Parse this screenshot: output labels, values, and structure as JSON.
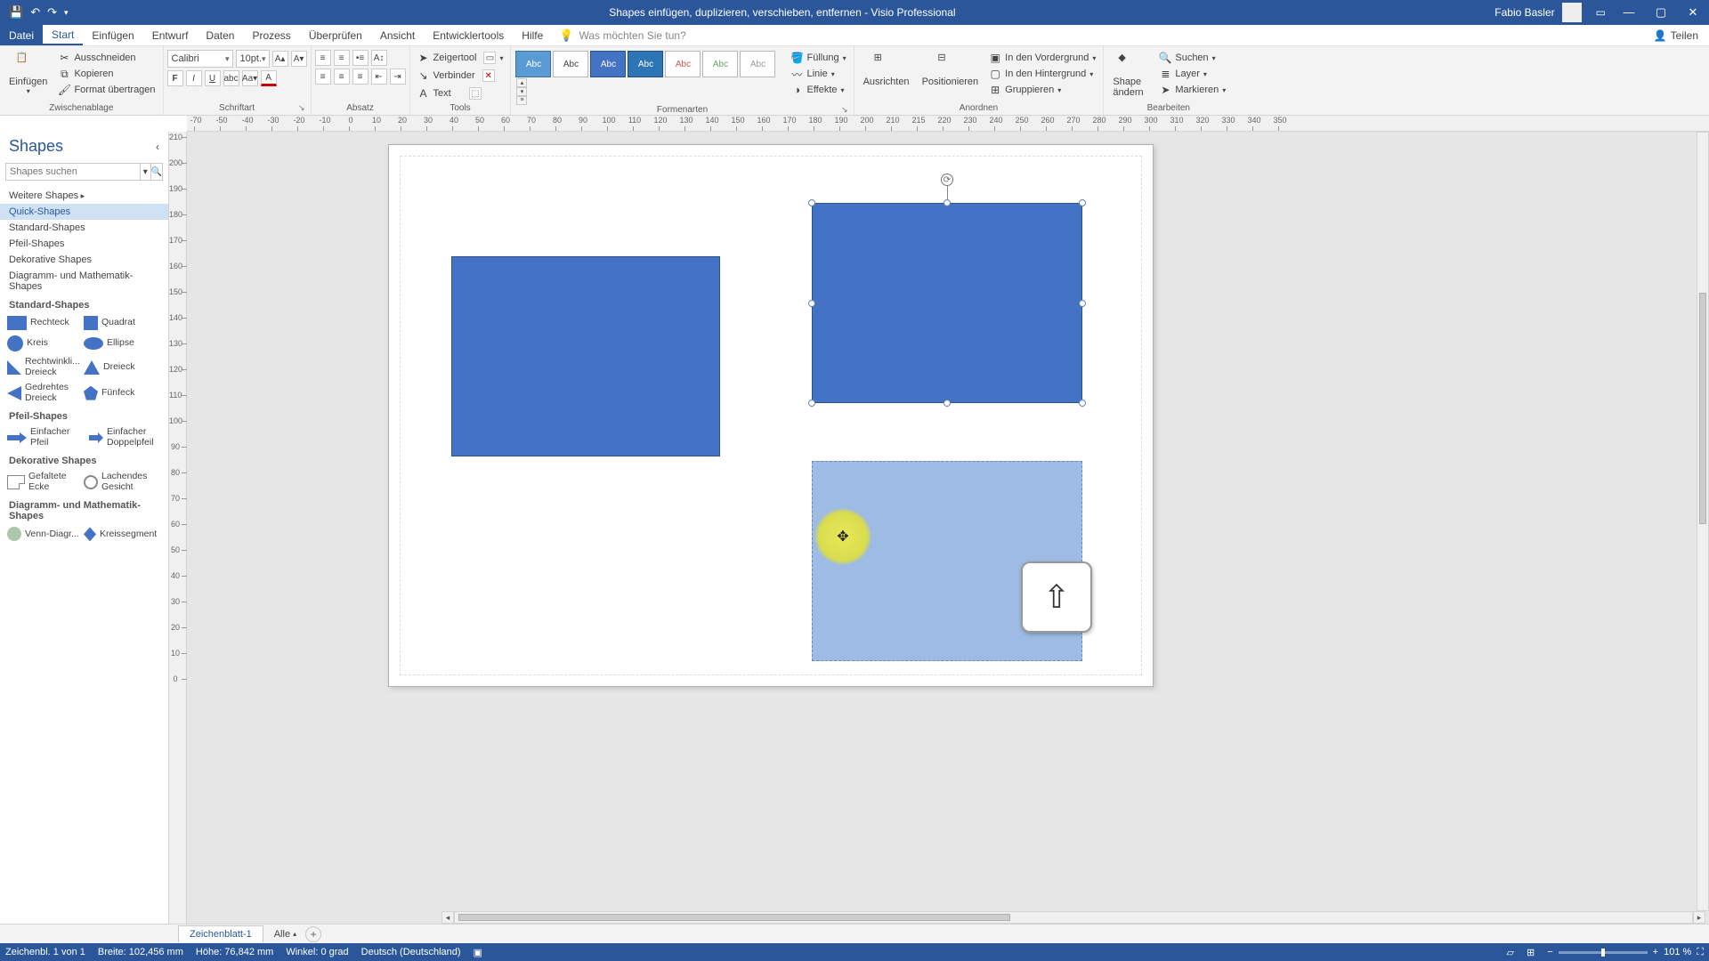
{
  "titlebar": {
    "doc_title": "Shapes einfügen, duplizieren, verschieben, entfernen  -  Visio Professional",
    "user_name": "Fabio Basler"
  },
  "tabs": {
    "file": "Datei",
    "start": "Start",
    "insert": "Einfügen",
    "design": "Entwurf",
    "data": "Daten",
    "process": "Prozess",
    "review": "Überprüfen",
    "view": "Ansicht",
    "devtools": "Entwicklertools",
    "help": "Hilfe",
    "tellme_placeholder": "Was möchten Sie tun?",
    "share": "Teilen"
  },
  "ribbon": {
    "clipboard": {
      "paste": "Einfügen",
      "cut": "Ausschneiden",
      "copy": "Kopieren",
      "format_painter": "Format übertragen",
      "group_label": "Zwischenablage"
    },
    "font": {
      "font_name": "Calibri",
      "font_size": "10pt.",
      "group_label": "Schriftart"
    },
    "paragraph": {
      "group_label": "Absatz"
    },
    "tools": {
      "pointer": "Zeigertool",
      "connector": "Verbinder",
      "text": "Text",
      "group_label": "Tools"
    },
    "styles": {
      "abc": "Abc",
      "group_label": "Formenarten",
      "fill": "Füllung",
      "line": "Linie",
      "effects": "Effekte"
    },
    "arrange": {
      "align": "Ausrichten",
      "position": "Positionieren",
      "bring_front": "In den Vordergrund",
      "send_back": "In den Hintergrund",
      "group": "Gruppieren",
      "group_label": "Anordnen"
    },
    "edit": {
      "change_shape": "Shape ändern",
      "find": "Suchen",
      "layer": "Layer",
      "select": "Markieren",
      "group_label": "Bearbeiten"
    }
  },
  "hruler_ticks": [
    -70,
    -50,
    -40,
    -30,
    -20,
    -10,
    0,
    10,
    20,
    30,
    40,
    50,
    60,
    70,
    80,
    90,
    100,
    110,
    120,
    130,
    140,
    150,
    160,
    170,
    180,
    190,
    200,
    210,
    215,
    220,
    230,
    240,
    250,
    260,
    270,
    280,
    290,
    300,
    310,
    320,
    330,
    340,
    350
  ],
  "vruler_ticks": [
    210,
    200,
    190,
    180,
    170,
    160,
    150,
    140,
    130,
    120,
    110,
    100,
    90,
    80,
    70,
    60,
    50,
    40,
    30,
    20,
    10,
    0
  ],
  "shapes_panel": {
    "title": "Shapes",
    "search_placeholder": "Shapes suchen",
    "more_shapes": "Weitere Shapes",
    "cats": {
      "quick": "Quick-Shapes",
      "standard_link": "Standard-Shapes",
      "pfeil_link": "Pfeil-Shapes",
      "deko_link": "Dekorative Shapes",
      "diag_link": "Diagramm- und Mathematik-Shapes"
    },
    "headers": {
      "standard": "Standard-Shapes",
      "pfeil": "Pfeil-Shapes",
      "deko": "Dekorative Shapes",
      "diag": "Diagramm- und Mathematik-Shapes"
    },
    "shapes": {
      "rechteck": "Rechteck",
      "quadrat": "Quadrat",
      "kreis": "Kreis",
      "ellipse": "Ellipse",
      "rechtdreieck": "Rechtwinkli... Dreieck",
      "dreieck": "Dreieck",
      "gedrehtes": "Gedrehtes Dreieck",
      "fuenfeck": "Fünfeck",
      "einf_pfeil": "Einfacher Pfeil",
      "einf_doppel": "Einfacher Doppelpfeil",
      "gefaltete": "Gefaltete Ecke",
      "lachendes": "Lachendes Gesicht",
      "venn": "Venn-Diagr...",
      "kreisseg": "Kreissegment"
    }
  },
  "sheetbar": {
    "sheet1": "Zeichenblatt-1",
    "all": "Alle"
  },
  "statusbar": {
    "page_info": "Zeichenbl. 1 von 1",
    "width": "Breite: 102,456 mm",
    "height": "Höhe: 76,842 mm",
    "angle": "Winkel: 0 grad",
    "lang": "Deutsch (Deutschland)",
    "zoom": "101 %"
  }
}
